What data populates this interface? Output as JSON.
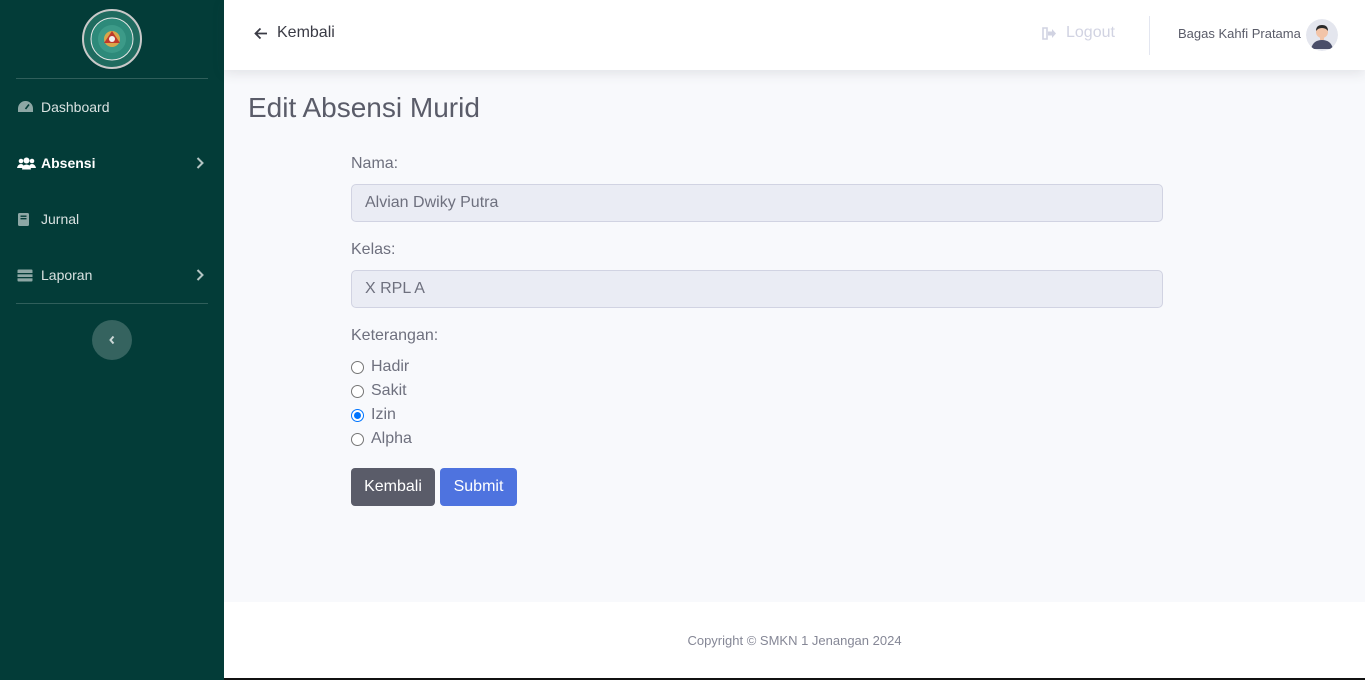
{
  "sidebar": {
    "items": [
      {
        "label": "Dashboard",
        "icon": "gauge-icon"
      },
      {
        "label": "Absensi",
        "icon": "users-icon",
        "active": true
      },
      {
        "label": "Jurnal",
        "icon": "book-icon"
      },
      {
        "label": "Laporan",
        "icon": "table-icon"
      }
    ]
  },
  "topbar": {
    "back_label": "Kembali",
    "logout_label": "Logout",
    "user_name": "Bagas Kahfi Pratama"
  },
  "page": {
    "title": "Edit Absensi Murid"
  },
  "form": {
    "nama_label": "Nama:",
    "nama_value": "Alvian Dwiky Putra",
    "kelas_label": "Kelas:",
    "kelas_value": "X RPL A",
    "keterangan_label": "Keterangan:",
    "options": [
      "Hadir",
      "Sakit",
      "Izin",
      "Alpha"
    ],
    "selected": "Izin",
    "back_button": "Kembali",
    "submit_button": "Submit"
  },
  "footer": {
    "copyright": "Copyright © SMKN 1 Jenangan 2024"
  },
  "colors": {
    "sidebar_bg": "#033c38",
    "primary": "#4e73df",
    "secondary": "#5a5c69",
    "radio_checked": "#0075ff"
  }
}
